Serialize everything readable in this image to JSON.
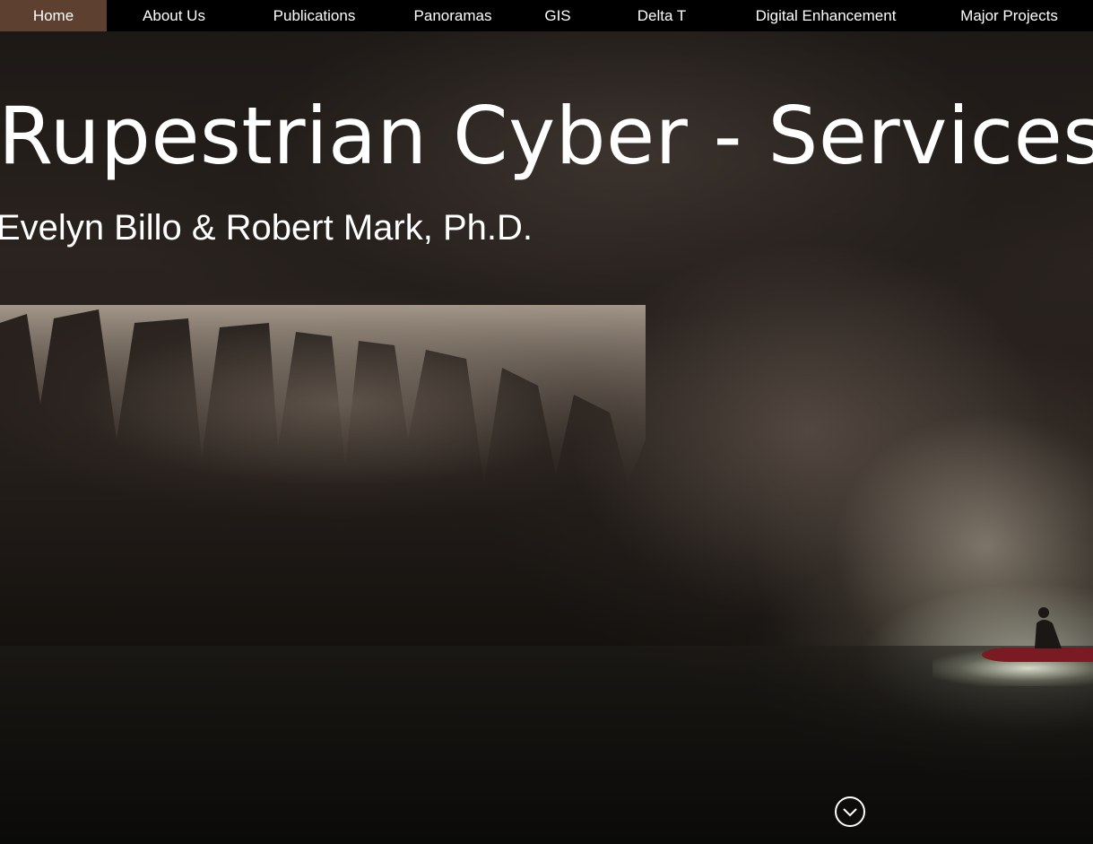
{
  "nav": {
    "items": [
      {
        "label": "Home",
        "active": true
      },
      {
        "label": "About Us"
      },
      {
        "label": "Publications"
      },
      {
        "label": "Panoramas"
      },
      {
        "label": "GIS"
      },
      {
        "label": "Delta T"
      },
      {
        "label": "Digital Enhancement"
      },
      {
        "label": "Major Projects"
      }
    ],
    "active_color": "#5e4031"
  },
  "hero": {
    "title": "Rupestrian Cyber - Services",
    "subtitle": "Evelyn Billo & Robert Mark, Ph.D.",
    "scroll_icon": "chevron-down-circle-icon"
  }
}
